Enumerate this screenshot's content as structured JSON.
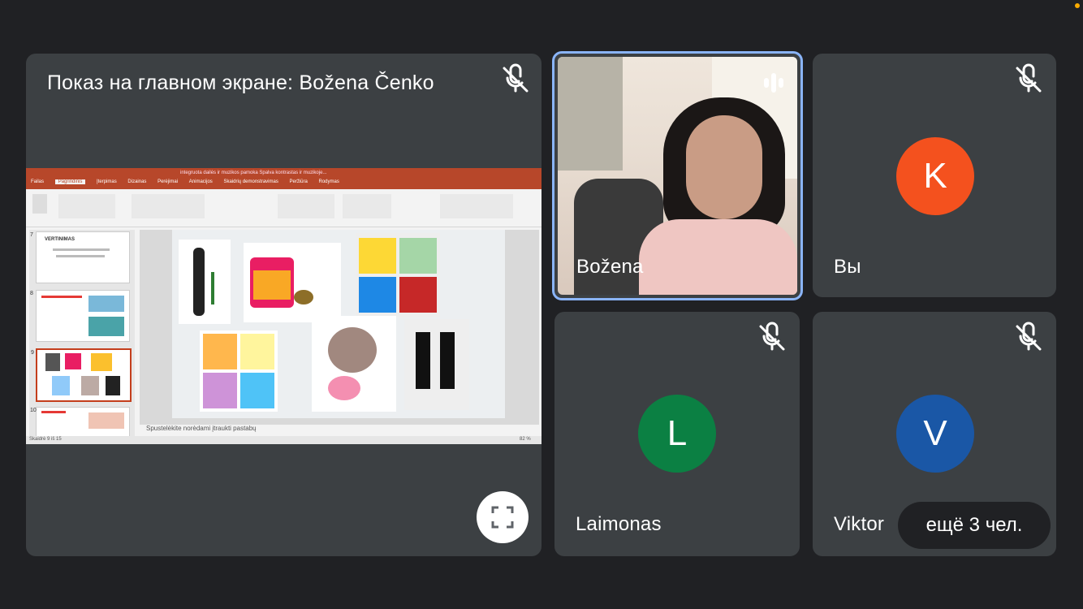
{
  "presentation": {
    "title": "Показ на главном экране: Božena Čenko",
    "window_title": "integruota dailės ir muzikos pamoka Spalva kontrastas ir muzikoje...",
    "tabs": [
      "Failas",
      "Pagrindinis",
      "Įterpimas",
      "Dizainas",
      "Perėjimai",
      "Animacijos",
      "Skaidrių demonstravimas",
      "Peržiūra",
      "Rodymas"
    ],
    "active_tab": "Pagrindinis",
    "thumbs": [
      "7",
      "8",
      "9",
      "10"
    ],
    "thumb7_title": "VERTINIMAS",
    "notes": "Spustelėkite norėdami įtraukti pastabų",
    "status": "Skaidrė 9 iš 15",
    "zoom": "82 %"
  },
  "participants": [
    {
      "name": "Božena"
    },
    {
      "name": "Вы",
      "initial": "K",
      "color": "#f4511e"
    },
    {
      "name": "Laimonas",
      "initial": "L",
      "color": "#0b8043"
    },
    {
      "name": "Viktor",
      "initial": "V",
      "color": "#1a57a6"
    }
  ],
  "more_chip": "ещё 3 чел.",
  "colors": {
    "background": "#202124",
    "tile": "#3c4043",
    "active_border": "#8ab4f8"
  }
}
